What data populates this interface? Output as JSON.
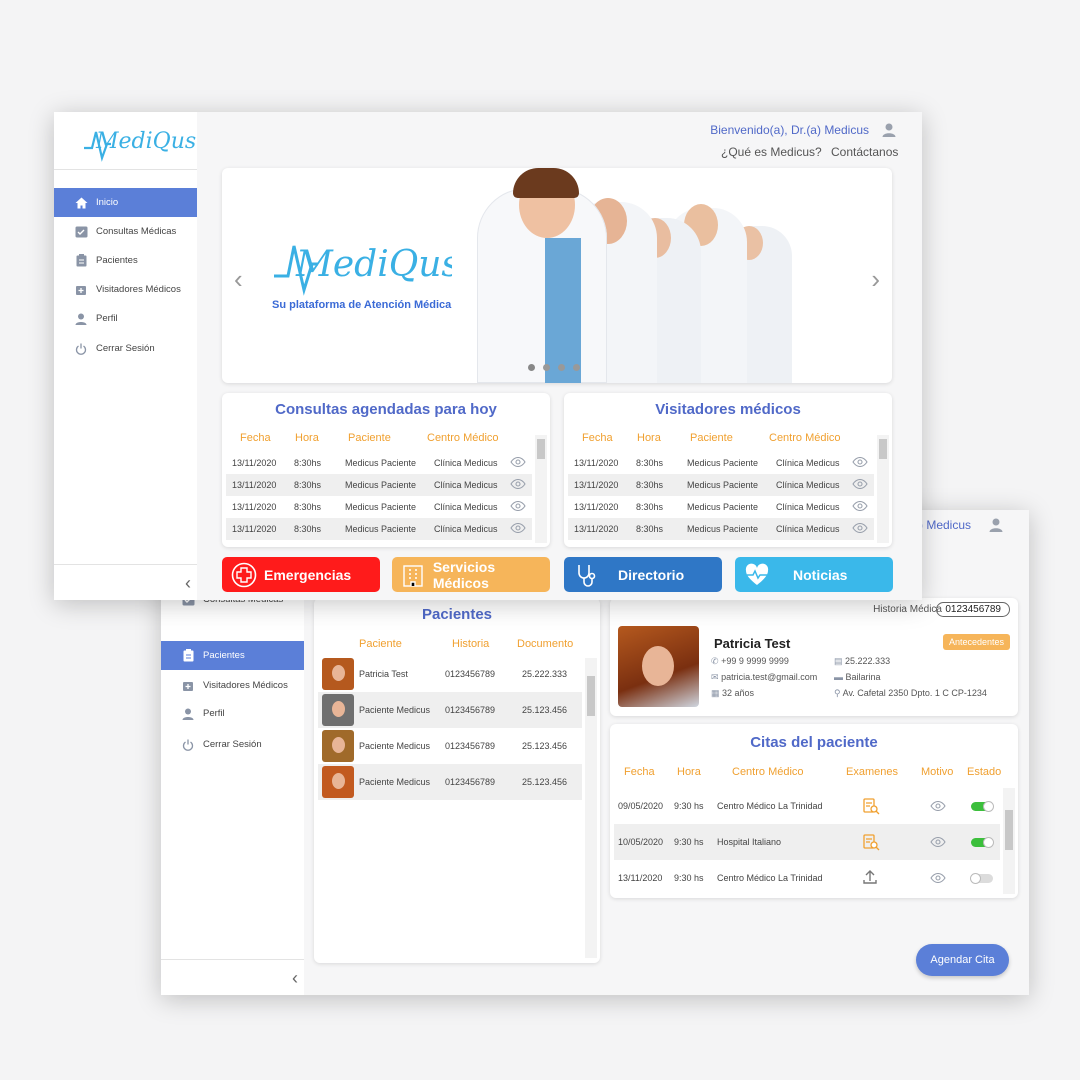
{
  "app": {
    "logo_text": "MediQus"
  },
  "sidebar": {
    "items": [
      {
        "label": "Inicio",
        "icon": "home-icon"
      },
      {
        "label": "Consultas Médicas",
        "icon": "checklist-icon"
      },
      {
        "label": "Pacientes",
        "icon": "clipboard-icon"
      },
      {
        "label": "Visitadores Médicos",
        "icon": "medical-bag-icon"
      },
      {
        "label": "Perfil",
        "icon": "user-icon"
      },
      {
        "label": "Cerrar Sesión",
        "icon": "power-icon"
      }
    ],
    "collapse_label": "‹"
  },
  "header": {
    "welcome": "Bienvenido(a), Dr.(a) Medicus",
    "welcome_partial": "a) Medicus",
    "links": [
      "¿Qué es Medicus?",
      "Contáctanos"
    ]
  },
  "banner": {
    "tagline": "Su plataforma de Atención Médica",
    "dots": 4,
    "prev": "‹",
    "next": "›"
  },
  "consultas": {
    "title": "Consultas agendadas para hoy",
    "columns": [
      "Fecha",
      "Hora",
      "Paciente",
      "Centro Médico"
    ],
    "rows": [
      [
        "13/11/2020",
        "8:30hs",
        "Medicus Paciente",
        "Clínica Medicus"
      ],
      [
        "13/11/2020",
        "8:30hs",
        "Medicus Paciente",
        "Clínica Medicus"
      ],
      [
        "13/11/2020",
        "8:30hs",
        "Medicus Paciente",
        "Clínica Medicus"
      ],
      [
        "13/11/2020",
        "8:30hs",
        "Medicus Paciente",
        "Clínica Medicus"
      ]
    ]
  },
  "visitadores": {
    "title": "Visitadores médicos",
    "columns": [
      "Fecha",
      "Hora",
      "Paciente",
      "Centro Médico"
    ],
    "rows": [
      [
        "13/11/2020",
        "8:30hs",
        "Medicus Paciente",
        "Clínica Medicus"
      ],
      [
        "13/11/2020",
        "8:30hs",
        "Medicus Paciente",
        "Clínica Medicus"
      ],
      [
        "13/11/2020",
        "8:30hs",
        "Medicus Paciente",
        "Clínica Medicus"
      ],
      [
        "13/11/2020",
        "8:30hs",
        "Medicus Paciente",
        "Clínica Medicus"
      ]
    ]
  },
  "quick_buttons": [
    {
      "label": "Emergencias",
      "color": "#ff1b1b",
      "icon": "cross-icon"
    },
    {
      "label": "Servicios Médicos",
      "color": "#f6b55a",
      "icon": "hospital-icon"
    },
    {
      "label": "Directorio",
      "color": "#2f77c6",
      "icon": "stethoscope-icon"
    },
    {
      "label": "Noticias",
      "color": "#3ab8ea",
      "icon": "heartbeat-icon"
    }
  ],
  "pacientes": {
    "title": "Pacientes",
    "columns": [
      "Paciente",
      "Historia",
      "Documento"
    ],
    "rows": [
      [
        "Patricia Test",
        "0123456789",
        "25.222.333"
      ],
      [
        "Paciente Medicus",
        "0123456789",
        "25.123.456"
      ],
      [
        "Paciente Medicus",
        "0123456789",
        "25.123.456"
      ],
      [
        "Paciente Medicus",
        "0123456789",
        "25.123.456"
      ]
    ]
  },
  "patient": {
    "historia_label": "Historia Médica",
    "historia_value": "0123456789",
    "name": "Patricia Test",
    "antecedentes_label": "Antecedentes",
    "phone": "+99 9 9999 9999",
    "email": "patricia.test@gmail.com",
    "age": "32 años",
    "documento": "25.222.333",
    "occupation": "Bailarina",
    "address": "Av. Cafetal 2350 Dpto. 1 C   CP-1234"
  },
  "citas": {
    "title": "Citas del paciente",
    "columns": [
      "Fecha",
      "Hora",
      "Centro Médico",
      "Examenes",
      "Motivo",
      "Estado"
    ],
    "rows": [
      {
        "fecha": "09/05/2020",
        "hora": "9:30 hs",
        "centro": "Centro Médico La Trinidad",
        "examen": "exam-search-icon",
        "estado": true
      },
      {
        "fecha": "10/05/2020",
        "hora": "9:30 hs",
        "centro": "Hospital Italiano",
        "examen": "exam-search-icon",
        "estado": true
      },
      {
        "fecha": "13/11/2020",
        "hora": "9:30 hs",
        "centro": "Centro Médico La Trinidad",
        "examen": "upload-icon",
        "estado": false
      }
    ]
  },
  "agendar_label": "Agendar Cita",
  "colors": {
    "accent": "#5b7fd8",
    "title_blue": "#5069c8",
    "orange": "#f0a030",
    "toggle_on": "#3cbf3c"
  }
}
